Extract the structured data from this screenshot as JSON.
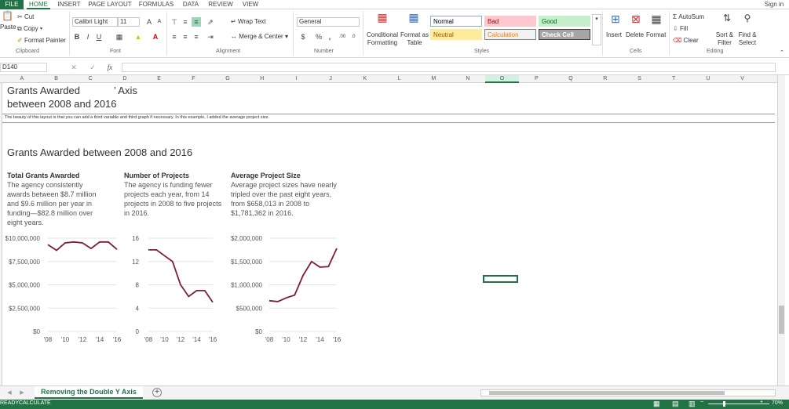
{
  "ribbon_tabs": [
    "FILE",
    "HOME",
    "INSERT",
    "PAGE LAYOUT",
    "FORMULAS",
    "DATA",
    "REVIEW",
    "VIEW"
  ],
  "sign_in": "Sign in",
  "clipboard": {
    "paste": "Paste",
    "cut": "Cut",
    "copy": "Copy",
    "format_painter": "Format Painter",
    "label": "Clipboard"
  },
  "font": {
    "name": "Calibri Light",
    "size": "11",
    "label": "Font",
    "grow": "A",
    "shrink": "A",
    "bold": "B",
    "italic": "I",
    "underline": "U"
  },
  "alignment": {
    "wrap": "Wrap Text",
    "merge": "Merge & Center",
    "label": "Alignment"
  },
  "number": {
    "format": "General",
    "currency": "$",
    "percent": "%",
    "comma": ",",
    "inc": ".00",
    "label": "Number"
  },
  "styles": {
    "conditional": "Conditional Formatting",
    "format_table": "Format as Table",
    "label": "Styles",
    "cells": [
      {
        "name": "Normal",
        "bg": "#ffffff",
        "fg": "#000000",
        "border": "#8ea9c1"
      },
      {
        "name": "Bad",
        "bg": "#ffc7ce",
        "fg": "#9c0006",
        "border": "#ffc7ce"
      },
      {
        "name": "Good",
        "bg": "#c6efce",
        "fg": "#006100",
        "border": "#c6efce"
      },
      {
        "name": "Neutral",
        "bg": "#ffeb9c",
        "fg": "#9c5700",
        "border": "#ffeb9c"
      },
      {
        "name": "Calculation",
        "bg": "#f2f2f2",
        "fg": "#fa7d00",
        "border": "#7f7f7f"
      },
      {
        "name": "Check Cell",
        "bg": "#a5a5a5",
        "fg": "#ffffff",
        "border": "#3f3f3f"
      }
    ]
  },
  "cells_group": {
    "insert": "Insert",
    "delete": "Delete",
    "format": "Format",
    "label": "Cells"
  },
  "editing": {
    "autosum": "AutoSum",
    "fill": "Fill",
    "clear": "Clear",
    "sort": "Sort & Filter",
    "find": "Find & Select",
    "label": "Editing"
  },
  "name_box": "D140",
  "formula_value": "",
  "columns": [
    "A",
    "B",
    "C",
    "D",
    "E",
    "F",
    "G",
    "H",
    "I",
    "J",
    "K",
    "L",
    "M",
    "N",
    "O",
    "P",
    "Q",
    "R",
    "S",
    "T",
    "U",
    "V"
  ],
  "sheet": {
    "title_line1": "Grants Awarded",
    "title_tail": "’ Axis",
    "title_line2": "between 2008 and 2016",
    "note": "The beauty of this layout is that you can add a third variable and third graph if necessary. In this example, I added the average project size.",
    "section_title": "Grants Awarded between 2008 and 2016",
    "panels": [
      {
        "heading": "Total Grants Awarded",
        "text": "The agency consistently awards between $8.7 million and $9.6 million per year in funding—$82.8 million over eight years."
      },
      {
        "heading": "Number of Projects",
        "text": "The agency is funding fewer projects each year, from 14 projects in 2008 to five projects in 2016."
      },
      {
        "heading": "Average Project Size",
        "text": "Average project sizes have nearly tripled over the past eight years, from $658,013 in 2008 to $1,781,362 in 2016."
      }
    ]
  },
  "chart_data": [
    {
      "type": "line",
      "x": [
        "2008",
        "2009",
        "2010",
        "2011",
        "2012",
        "2013",
        "2014",
        "2015",
        "2016"
      ],
      "xticks": [
        "'08",
        "'10",
        "'12",
        "'14",
        "'16"
      ],
      "series": [
        {
          "values": [
            9300000,
            8700000,
            9500000,
            9600000,
            9500000,
            8900000,
            9600000,
            9600000,
            8800000
          ]
        }
      ],
      "ylim": [
        0,
        10000000
      ],
      "yticks": [
        "$0",
        "$2,500,000",
        "$5,000,000",
        "$7,500,000",
        "$10,000,000"
      ],
      "color": "#7f1d35",
      "grid": true
    },
    {
      "type": "line",
      "x": [
        "2008",
        "2009",
        "2010",
        "2011",
        "2012",
        "2013",
        "2014",
        "2015",
        "2016"
      ],
      "xticks": [
        "'08",
        "'10",
        "'12",
        "'14",
        "'16"
      ],
      "series": [
        {
          "values": [
            14,
            14,
            13,
            12,
            8,
            6,
            7,
            7,
            5
          ]
        }
      ],
      "ylim": [
        0,
        16
      ],
      "yticks": [
        "0",
        "4",
        "8",
        "12",
        "16"
      ],
      "color": "#7f1d35",
      "grid": true
    },
    {
      "type": "line",
      "x": [
        "2008",
        "2009",
        "2010",
        "2011",
        "2012",
        "2013",
        "2014",
        "2015",
        "2016"
      ],
      "xticks": [
        "'08",
        "'10",
        "'12",
        "'14",
        "'16"
      ],
      "series": [
        {
          "values": [
            658013,
            640000,
            720000,
            780000,
            1200000,
            1500000,
            1380000,
            1390000,
            1781362
          ]
        }
      ],
      "ylim": [
        0,
        2000000
      ],
      "yticks": [
        "$0",
        "$500,000",
        "$1,000,000",
        "$1,500,000",
        "$2,000,000"
      ],
      "color": "#7f1d35",
      "grid": true
    }
  ],
  "sheet_tab": "Removing the Double Y Axis",
  "status": {
    "mode": "READY",
    "calc": "CALCULATE",
    "zoom": "70%"
  }
}
